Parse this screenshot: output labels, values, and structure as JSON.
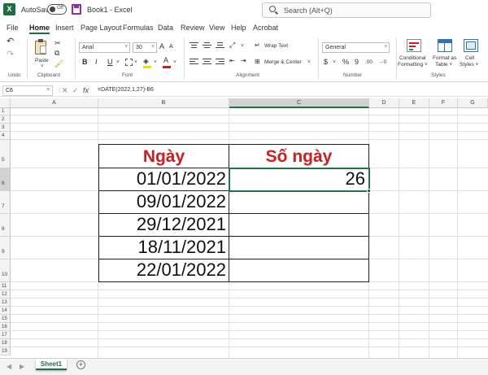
{
  "titlebar": {
    "autosave_label": "AutoSave",
    "autosave_state": "Off",
    "doc_title": "Book1  -  Excel",
    "search_placeholder": "Search (Alt+Q)"
  },
  "menu": {
    "tabs": [
      "File",
      "Home",
      "Insert",
      "Page Layout",
      "Formulas",
      "Data",
      "Review",
      "View",
      "Help",
      "Acrobat"
    ],
    "active": "Home"
  },
  "ribbon": {
    "undo_label": "Undo",
    "paste_label": "Paste",
    "clipboard_label": "Clipboard",
    "font_name": "Arial",
    "font_size": "30",
    "font_label": "Font",
    "bold": "B",
    "italic": "I",
    "underline": "U",
    "grow_font": "A",
    "shrink_font": "A",
    "wrap_text": "Wrap Text",
    "merge_center": "Merge & Center",
    "alignment_label": "Alignment",
    "number_format": "General",
    "currency": "$",
    "percent": "%",
    "comma": "9",
    "increase_decimal": ".00",
    "decrease_decimal": "→0",
    "number_label": "Number",
    "conditional_formatting": [
      "Conditional",
      "Formatting ˅"
    ],
    "format_as_table": [
      "Format as",
      "Table ˅"
    ],
    "cell_styles": [
      "Cell",
      "Styles ˅"
    ],
    "styles_label": "Styles",
    "colors": {
      "accent": "#217346",
      "font_color": "#d21b1b",
      "fill_color": "#ffd700"
    }
  },
  "formula_bar": {
    "name_box": "C6",
    "cancel": "✕",
    "enter": "✓",
    "fx": "fx",
    "formula": "=DATE(2022,1,27)-B6"
  },
  "sheet": {
    "columns": [
      "A",
      "B",
      "C",
      "D",
      "E",
      "F",
      "G"
    ],
    "selected_column": "C",
    "rows": [
      "1",
      "2",
      "3",
      "4",
      "5",
      "6",
      "7",
      "8",
      "9",
      "10",
      "11",
      "12",
      "13",
      "14",
      "15",
      "16",
      "17",
      "18",
      "19"
    ],
    "selected_row": "6",
    "table": {
      "header_date": "Ngày",
      "header_days": "Số ngày",
      "dates": [
        "01/01/2022",
        "09/01/2022",
        "29/12/2021",
        "18/11/2021",
        "22/01/2022"
      ],
      "days": [
        "26",
        "",
        "",
        "",
        ""
      ]
    },
    "active_cell": "C6"
  },
  "sheet_tabs": {
    "tabs": [
      "Sheet1"
    ],
    "prev": "◀",
    "next": "▶",
    "add": "+"
  }
}
